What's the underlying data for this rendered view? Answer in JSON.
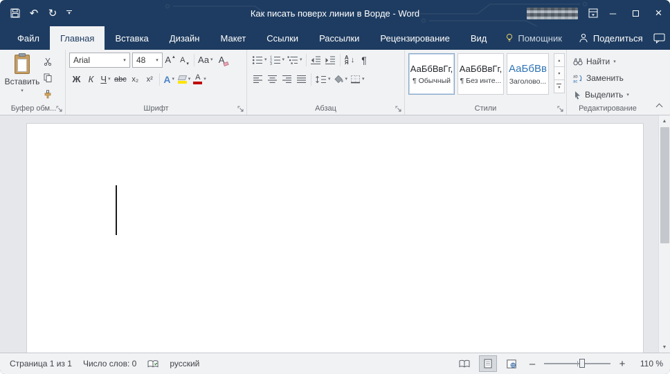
{
  "colors": {
    "titlebar": "#1e3c61",
    "ribbon_bg": "#f1f2f4",
    "heading_blue": "#2e74b5",
    "font_color_red": "#c00000",
    "highlight_yellow": "#ffe400"
  },
  "icons": {
    "undo": "↶",
    "redo": "↻",
    "dropdown": "▾",
    "up": "▴",
    "pilcrow": "¶",
    "minimize": "─",
    "close": "×",
    "scroll_up": "▲",
    "scroll_down": "▼",
    "sort_arrow": "↓"
  },
  "titlebar": {
    "title": "Как писать поверх линии в Ворде  -  Word"
  },
  "tabs": [
    "Файл",
    "Главная",
    "Вставка",
    "Дизайн",
    "Макет",
    "Ссылки",
    "Рассылки",
    "Рецензирование",
    "Вид",
    "Помощник"
  ],
  "share_label": "Поделиться",
  "ribbon": {
    "clipboard": {
      "paste": "Вставить",
      "label": "Буфер обм..."
    },
    "font": {
      "family": "Arial",
      "size": "48",
      "grow": "А",
      "shrink": "А",
      "case": "Аа",
      "clear": "А",
      "bold": "Ж",
      "italic": "К",
      "underline": "Ч",
      "strike": "abc",
      "subscript": "x₂",
      "superscript": "x²",
      "effects": "А",
      "highlight_color_letter": "",
      "color": "А",
      "label": "Шрифт"
    },
    "paragraph": {
      "sort_a": "А",
      "sort_z": "Я",
      "label": "Абзац"
    },
    "styles": {
      "items": [
        {
          "preview": "АаБбВвГг,",
          "name": "¶ Обычный"
        },
        {
          "preview": "АаБбВвГг,",
          "name": "¶ Без инте..."
        },
        {
          "preview": "АаБбВв",
          "name": "Заголово..."
        }
      ],
      "label": "Стили"
    },
    "editing": {
      "find": "Найти",
      "replace": "Заменить",
      "select": "Выделить",
      "label": "Редактирование"
    }
  },
  "statusbar": {
    "page": "Страница 1 из 1",
    "words": "Число слов: 0",
    "language": "русский",
    "zoom_out": "–",
    "zoom_in": "+",
    "zoom": "110 %"
  }
}
